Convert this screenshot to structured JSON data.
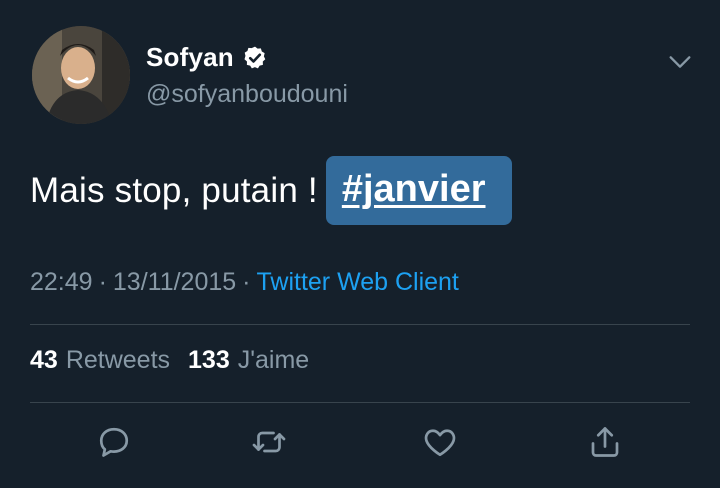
{
  "author": {
    "name": "Sofyan",
    "handle": "@sofyanboudouni",
    "verified": true
  },
  "tweet": {
    "text": "Mais stop, putain !",
    "hashtag": "#janvier",
    "time": "22:49",
    "separator": "·",
    "date": "13/11/2015",
    "client": "Twitter Web Client"
  },
  "stats": {
    "retweets_count": "43",
    "retweets_label": "Retweets",
    "likes_count": "133",
    "likes_label": "J'aime"
  },
  "icons": {
    "menu": "chevron-down-icon",
    "reply": "reply-icon",
    "retweet": "retweet-icon",
    "like": "heart-icon",
    "share": "share-icon",
    "verified": "verified-badge-icon"
  },
  "colors": {
    "background": "#15202b",
    "secondary_text": "#8899a6",
    "link": "#1da1f2",
    "hashtag_highlight": "#336b9b",
    "divider": "#38444d"
  }
}
